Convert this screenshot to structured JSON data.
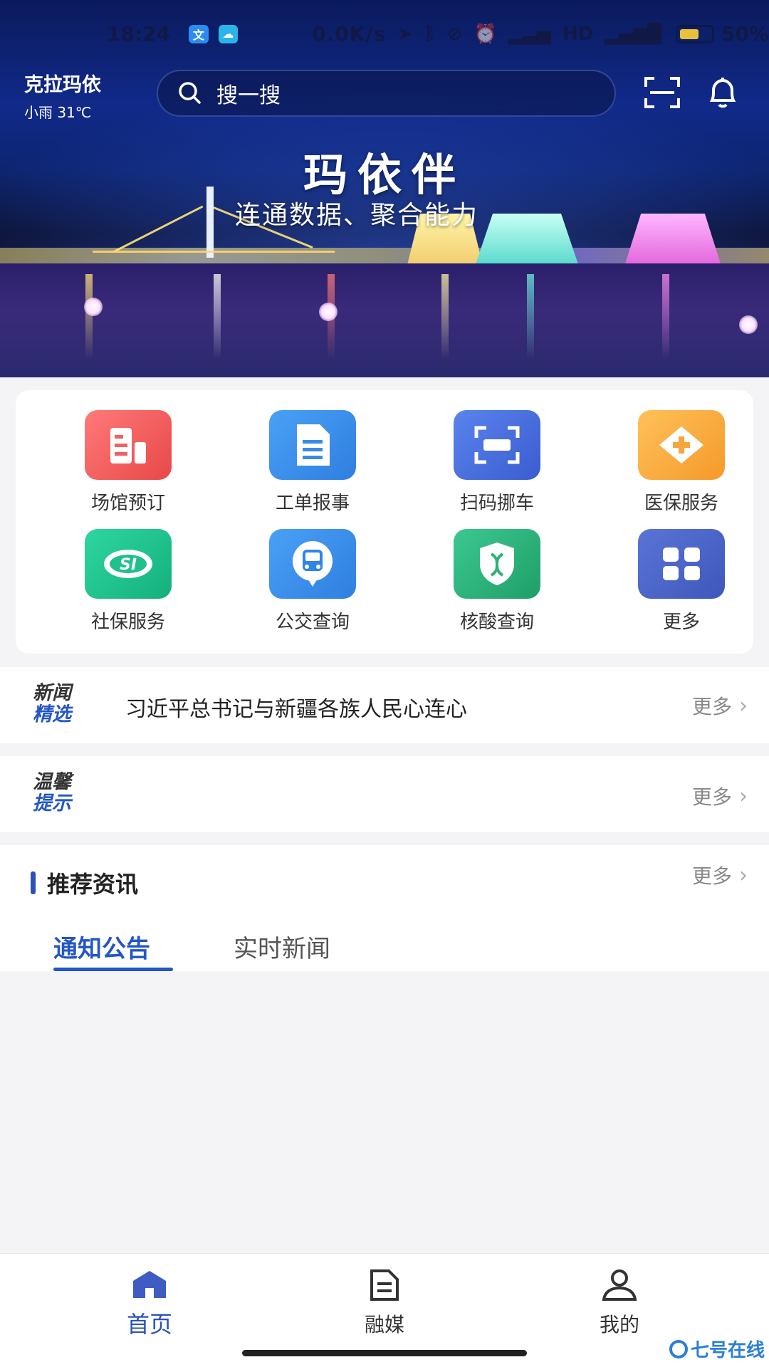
{
  "status_bar": {
    "time": "18:24",
    "app1": "文",
    "net_speed": "0.0K/s",
    "battery_pct": "50%"
  },
  "header": {
    "city": "克拉玛依",
    "weather": "小雨  31℃",
    "search_placeholder": "搜一搜"
  },
  "banner": {
    "title": "玛依伴",
    "subtitle": "连通数据、聚合能力"
  },
  "services": [
    {
      "label": "场馆预订",
      "icon": "building-icon",
      "color": "#f05656"
    },
    {
      "label": "工单报事",
      "icon": "document-icon",
      "color": "#2f86e6"
    },
    {
      "label": "扫码挪车",
      "icon": "scan-icon",
      "color": "#4670dc"
    },
    {
      "label": "医保服务",
      "icon": "medical-plus-icon",
      "color": "#f4a43a"
    },
    {
      "label": "社保服务",
      "icon": "social-security-icon",
      "color": "#1fc08e"
    },
    {
      "label": "公交查询",
      "icon": "bus-icon",
      "color": "#2f86e6"
    },
    {
      "label": "核酸查询",
      "icon": "dna-shield-icon",
      "color": "#2fb07a"
    },
    {
      "label": "更多",
      "icon": "grid-icon",
      "color": "#4a63c8"
    }
  ],
  "news": {
    "tag_line1": "新闻",
    "tag_line2": "精选",
    "headline": "习近平总书记与新疆各族人民心连心",
    "more": "更多"
  },
  "tips": {
    "tag_line1": "温馨",
    "tag_line2": "提示",
    "more": "更多"
  },
  "recommend": {
    "title": "推荐资讯",
    "more": "更多",
    "tabs": [
      "通知公告",
      "实时新闻"
    ]
  },
  "bottom_nav": [
    {
      "label": "首页",
      "icon": "home-icon"
    },
    {
      "label": "融媒",
      "icon": "media-doc-icon"
    },
    {
      "label": "我的",
      "icon": "user-icon"
    }
  ],
  "watermark": "七号在线",
  "colors": {
    "accent": "#2356c6",
    "nav_active": "#2b52b8"
  }
}
